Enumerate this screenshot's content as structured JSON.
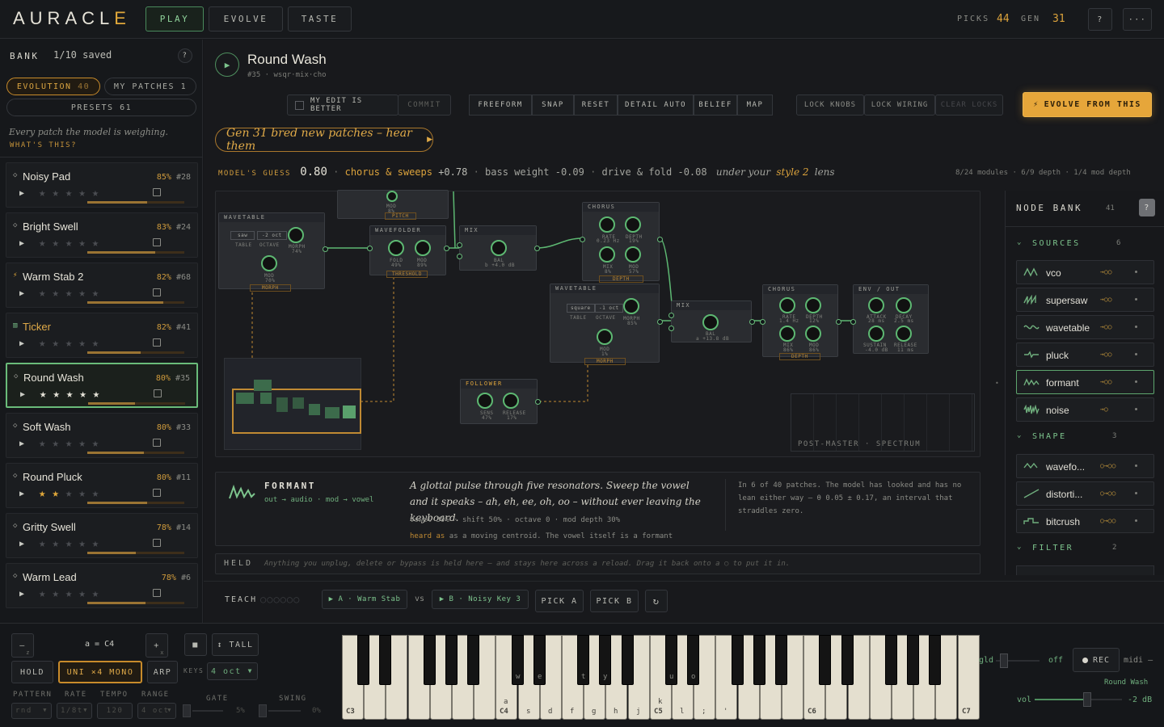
{
  "app": {
    "logo_main": "AURACL",
    "logo_accent": "E",
    "tabs": [
      "PLAY",
      "EVOLVE",
      "TASTE"
    ],
    "picks_label": "PICKS",
    "picks_value": "44",
    "gen_label": "GEN",
    "gen_value": "31",
    "help": "?",
    "more": "···"
  },
  "bank": {
    "title": "BANK",
    "saved": "1/10 saved",
    "help": "?",
    "chips": {
      "evolution": "EVOLUTION",
      "evolution_count": "40",
      "my_patches": "MY PATCHES",
      "my_patches_count": "1",
      "presets": "PRESETS",
      "presets_count": "61"
    },
    "note": "Every patch the model is weighing.",
    "whats_this": "WHAT'S THIS?",
    "cards": [
      {
        "name": "Noisy Pad",
        "glyph": "◇",
        "score": "85%",
        "id": "#28",
        "progress": 0.62,
        "stars": 0
      },
      {
        "name": "Bright Swell",
        "glyph": "◇",
        "score": "83%",
        "id": "#24",
        "progress": 0.7,
        "stars": 0
      },
      {
        "name": "Warm Stab 2",
        "glyph": "⚡",
        "score": "82%",
        "id": "#68",
        "progress": 0.78,
        "stars": 0
      },
      {
        "name": "Ticker",
        "glyph": "▥",
        "score": "82%",
        "id": "#41",
        "progress": 0.55,
        "stars": 0
      },
      {
        "name": "Round Wash",
        "glyph": "◇",
        "score": "80%",
        "id": "#35",
        "progress": 0.48,
        "stars": 5
      },
      {
        "name": "Soft Wash",
        "glyph": "◇",
        "score": "80%",
        "id": "#33",
        "progress": 0.58,
        "stars": 0
      },
      {
        "name": "Round Pluck",
        "glyph": "◇",
        "score": "80%",
        "id": "#11",
        "progress": 0.62,
        "stars": 2
      },
      {
        "name": "Gritty Swell",
        "glyph": "◇",
        "score": "78%",
        "id": "#14",
        "progress": 0.5,
        "stars": 0
      },
      {
        "name": "Warm Lead",
        "glyph": "◇",
        "score": "78%",
        "id": "#6",
        "progress": 0.6,
        "stars": 0
      }
    ]
  },
  "patch": {
    "name": "Round Wash",
    "sub": "#35 · wsqr·mix·cho"
  },
  "toolbar": {
    "my_edit": "MY EDIT IS BETTER",
    "commit": "COMMIT",
    "modes": [
      "FREEFORM",
      "SNAP",
      "RESET",
      "DETAIL AUTO",
      "BELIEF",
      "MAP"
    ],
    "locks": [
      "LOCK KNOBS",
      "LOCK WIRING",
      "CLEAR LOCKS"
    ],
    "evolve": "EVOLVE FROM THIS"
  },
  "gen_banner": "Gen 31 bred new patches – hear them",
  "guess": {
    "label": "MODEL'S GUESS",
    "value": "0.80",
    "t1": "chorus & sweeps",
    "v1": "+0.78",
    "t2": "bass weight",
    "v2": "-0.09",
    "t3": "drive & fold",
    "v3": "-0.08",
    "lens_pre": "under your",
    "lens_style": "style 2",
    "lens_post": "lens",
    "stats": "8/24 modules · 6/9 depth · 1/4 mod depth"
  },
  "nodes": {
    "wavetable1": {
      "title": "WAVETABLE",
      "chip1": "saw",
      "chip2": "-2 oct",
      "k1": "TABLE",
      "k2": "OCTAVE",
      "k3": "MORPH",
      "k3v": "74%",
      "k4": "MOD",
      "k4v": "70%",
      "tag": "MORPH"
    },
    "wavefolder": {
      "title": "WAVEFOLDER",
      "k1": "FOLD",
      "k1v": "49%",
      "k2": "MOD",
      "k2v": "89%",
      "tag": "THRESHOLD"
    },
    "mix1": {
      "title": "MIX",
      "k1": "BAL",
      "k1v": "b +4.0 dB"
    },
    "chorus1": {
      "title": "CHORUS",
      "k1": "RATE",
      "k1v": "0.23 Hz",
      "k2": "DEPTH",
      "k2v": "19%",
      "k3": "MIX",
      "k3v": "8%",
      "k4": "MOD",
      "k4v": "57%",
      "tag": "DEPTH"
    },
    "wavetable2": {
      "title": "WAVETABLE",
      "chip1": "square",
      "chip2": "-1 oct",
      "k1": "TABLE",
      "k2": "OCTAVE",
      "k3": "MORPH",
      "k3v": "85%",
      "k4": "MOD",
      "k4v": "1%",
      "tag": "MORPH"
    },
    "mix2": {
      "title": "MIX",
      "k1": "BAL",
      "k1v": "a +13.8 dB"
    },
    "chorus2": {
      "title": "CHORUS",
      "k1": "RATE",
      "k1v": "1.4 Hz",
      "k2": "DEPTH",
      "k2v": "12%",
      "k3": "MIX",
      "k3v": "86%",
      "k4": "MOD",
      "k4v": "86%",
      "tag": "DEPTH"
    },
    "env": {
      "title": "ENV / OUT",
      "k1": "ATTACK",
      "k1v": "28 ms",
      "k2": "DECAY",
      "k2v": "2.5 ms",
      "k3": "SUSTAIN",
      "k3v": "-4.0 dB",
      "k4": "RELEASE",
      "k4v": "11 ms"
    },
    "follower": {
      "title": "FOLLOWER",
      "k1": "SENS",
      "k1v": "47%",
      "k2": "RELEASE",
      "k2v": "17%"
    },
    "top_tag": "PITCH",
    "top_mod": "MOD",
    "top_mod_v": "8%",
    "spectrum": "POST-MASTER · SPECTRUM"
  },
  "info": {
    "title": "FORMANT",
    "routing": "out → audio · mod → vowel",
    "desc": "A glottal pulse through five resonators. Sweep the vowel and it speaks – ah, eh, ee, oh, oo – without ever leaving the keyboard.",
    "params": "vowel 30% · shift 50% · octave 0 · mod depth 30%",
    "heard_label": "heard as",
    "heard": "as a moving centroid. The vowel itself is a formant",
    "stats": "In 6 of 40 patches. The model has looked and has no lean either way – θ 0.05 ± 0.17, an interval that straddles zero."
  },
  "held": {
    "label": "HELD",
    "text": "Anything you unplug, delete or bypass is held here – and stays here across a reload. Drag it back onto a ○ to put it in."
  },
  "teach": {
    "label": "TEACH",
    "a": "▶ A · Warm Stab",
    "vs": "vs",
    "b": "▶ B · Noisy Key 3",
    "pick_a": "PICK A",
    "pick_b": "PICK B",
    "refresh": "↻"
  },
  "nodebank": {
    "title": "NODE BANK",
    "count": "41",
    "help": "?",
    "sources_label": "SOURCES",
    "sources_count": "6",
    "sources": [
      {
        "name": "vco",
        "ports": "→○○"
      },
      {
        "name": "supersaw",
        "ports": "→○○"
      },
      {
        "name": "wavetable",
        "ports": "→○○"
      },
      {
        "name": "pluck",
        "ports": "→○○"
      },
      {
        "name": "formant",
        "ports": "→○○"
      },
      {
        "name": "noise",
        "ports": "→○"
      }
    ],
    "shape_label": "SHAPE",
    "shape_count": "3",
    "shape": [
      {
        "name": "wavefo...",
        "ports": "○→○○"
      },
      {
        "name": "distorti...",
        "ports": "○→○○"
      },
      {
        "name": "bitcrush",
        "ports": "○→○○"
      }
    ],
    "filter_label": "FILTER",
    "filter_count": "2"
  },
  "keyboard": {
    "minus": "–",
    "z": "z",
    "octave": "a = C4",
    "plus": "+",
    "x": "x",
    "stop": "■",
    "tall": "↕ TALL",
    "hold": "HOLD",
    "uni": "UNI ×4 MONO",
    "arp": "ARP",
    "keys_label": "KEYS",
    "keys_value": "4 oct",
    "pattern": "PATTERN",
    "rate": "RATE",
    "tempo": "TEMPO",
    "range": "RANGE",
    "gate": "GATE",
    "swing": "SWING",
    "pattern_v": "rnd",
    "rate_v": "1/8t",
    "tempo_v": "120",
    "range_v": "4 oct",
    "gate_v": "5%",
    "swing_v": "0%",
    "c_labels": [
      "C3",
      "C4",
      "C5",
      "C6",
      "C7"
    ],
    "key_letters": [
      "a",
      "s",
      "d",
      "f",
      "g",
      "h",
      "j",
      "k",
      "l",
      ";",
      "'"
    ],
    "black_letters": [
      "w",
      "e",
      "t",
      "y",
      "u",
      "o",
      "p"
    ],
    "gld": "gld",
    "off": "off",
    "rec": "REC",
    "midi": "midi –",
    "patch": "Round Wash",
    "vol": "vol",
    "vol_v": "-2 dB",
    "gld_level": 0.1,
    "vol_level": 0.6
  }
}
